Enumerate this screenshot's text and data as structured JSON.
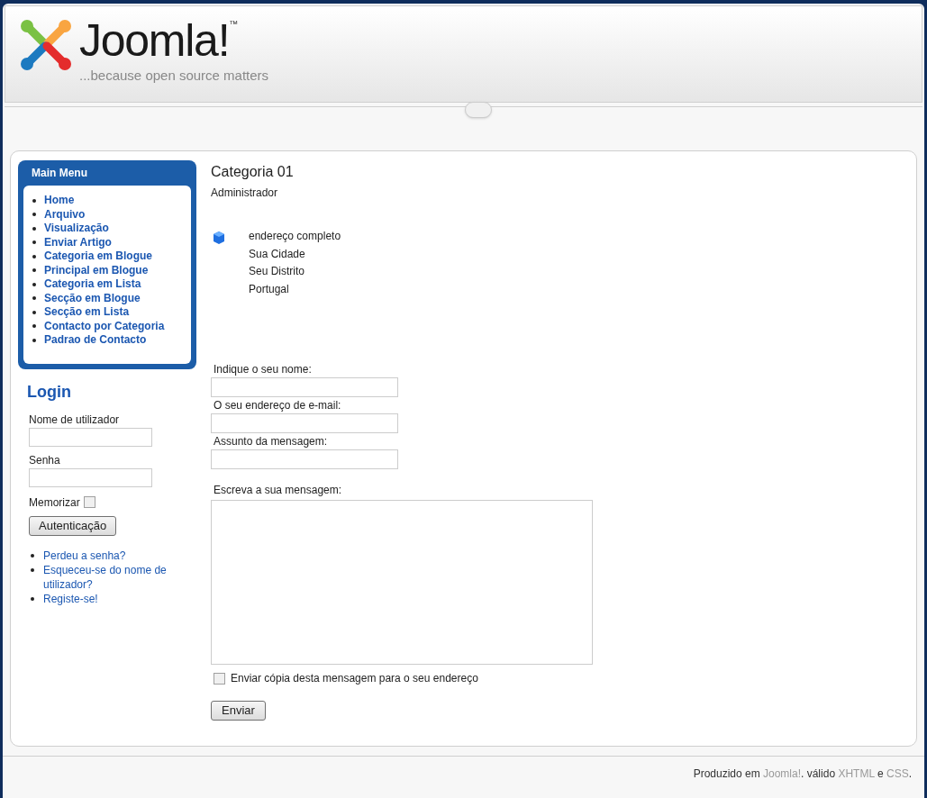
{
  "header": {
    "logo_text": "Joomla!",
    "trademark": "™",
    "tagline": "...because open source matters"
  },
  "main_menu": {
    "title": "Main Menu",
    "items": [
      "Home",
      "Arquivo",
      "Visualização",
      "Enviar Artigo",
      "Categoria em Blogue",
      "Principal em Blogue",
      "Categoria em Lista",
      "Secção em Blogue",
      "Secção em Lista",
      "Contacto por Categoria",
      "Padrao de Contacto"
    ]
  },
  "login": {
    "title": "Login",
    "username_label": "Nome de utilizador",
    "password_label": "Senha",
    "remember_label": "Memorizar",
    "remember_checked": false,
    "button": "Autenticação",
    "links": [
      "Perdeu a senha?",
      "Esqueceu-se do nome de utilizador?",
      "Registe-se!"
    ]
  },
  "contact": {
    "title": "Categoria 01",
    "position": "Administrador",
    "address": [
      "endereço completo",
      "Sua Cidade",
      "Seu Distrito",
      "Portugal"
    ],
    "fields": [
      {
        "label": "Indique o seu nome:",
        "kind": "input"
      },
      {
        "label": "O seu endereço de e-mail:",
        "kind": "input"
      },
      {
        "label": "Assunto da mensagem:",
        "kind": "input"
      },
      {
        "label": "Escreva a sua mensagem:",
        "kind": "textarea"
      }
    ],
    "copy_label": "Enviar cópia desta mensagem para o seu endereço",
    "copy_checked": false,
    "submit": "Enviar"
  },
  "footer": [
    {
      "text": "Produzido em ",
      "link": false
    },
    {
      "text": "Joomla!",
      "link": true
    },
    {
      "text": ". válido ",
      "link": false
    },
    {
      "text": "XHTML",
      "link": true
    },
    {
      "text": " e ",
      "link": false
    },
    {
      "text": "CSS",
      "link": true
    },
    {
      "text": ".",
      "link": false
    }
  ]
}
